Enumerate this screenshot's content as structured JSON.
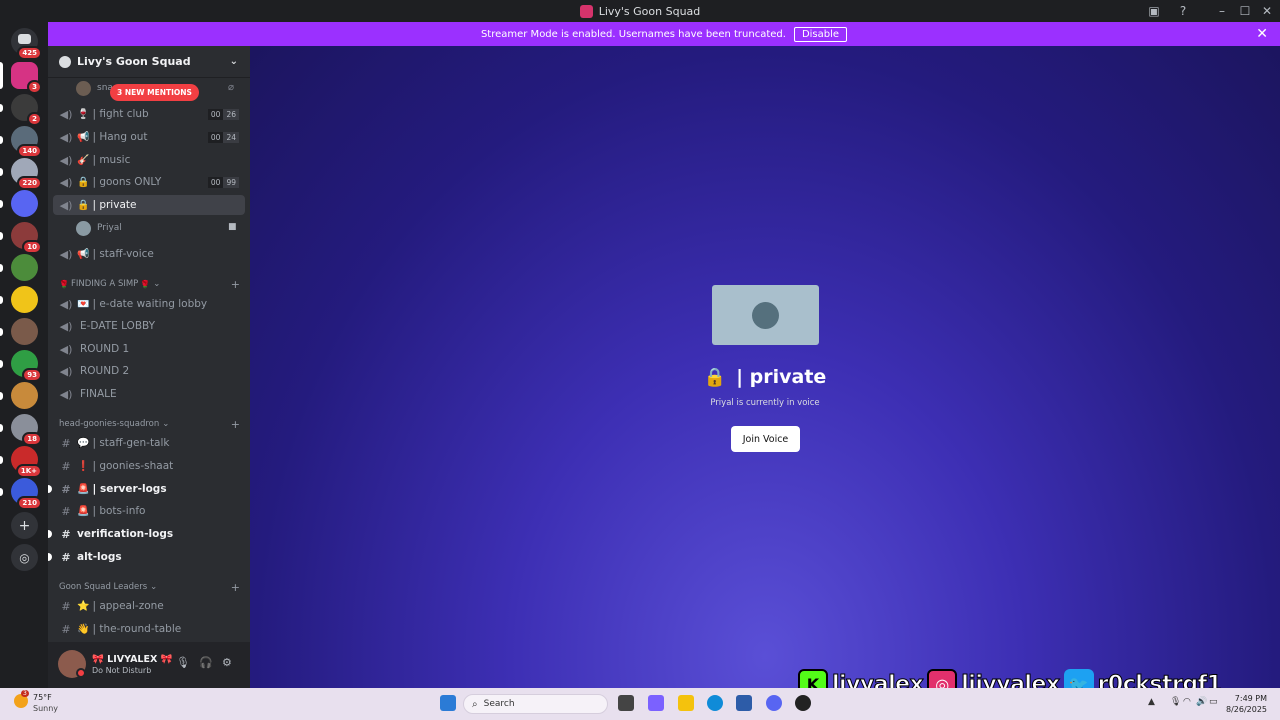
{
  "window": {
    "title": "Livy's Goon Squad"
  },
  "banner": {
    "text": "Streamer Mode is enabled. Usernames have been truncated.",
    "button": "Disable"
  },
  "rail": {
    "home_badge": "425",
    "servers": [
      {
        "badge": "3",
        "color": "#d63384"
      },
      {
        "badge": "2",
        "color": "#3b3b3b"
      },
      {
        "badge": "140",
        "color": "#5a6b7a"
      },
      {
        "badge": "220",
        "color": "#a0a8b8"
      },
      {
        "badge": "",
        "color": "#5865f2"
      },
      {
        "badge": "10",
        "color": "#8c3b3b"
      },
      {
        "badge": "",
        "color": "#4c8c3b"
      },
      {
        "badge": "",
        "color": "#f0c419"
      },
      {
        "badge": "",
        "color": "#7a5a4a"
      },
      {
        "badge": "93",
        "color": "#2f9e44"
      },
      {
        "badge": "",
        "color": "#c88a3b"
      },
      {
        "badge": "18",
        "color": "#8a8f9a"
      },
      {
        "badge": "1K+",
        "color": "#c92a2a"
      },
      {
        "badge": "210",
        "color": "#3b5bdb"
      }
    ]
  },
  "sidebar": {
    "server_name": "Livy's Goon Squad",
    "mentions_pill": "3 NEW MENTIONS",
    "top_user": "sna",
    "voice_channels": [
      {
        "name": "| fight club",
        "emoji": "🍷",
        "count": [
          "00",
          "26"
        ]
      },
      {
        "name": "| Hang out",
        "emoji": "📢",
        "count": [
          "00",
          "24"
        ]
      },
      {
        "name": "| music",
        "emoji": "🎸",
        "count": null
      },
      {
        "name": "| goons ONLY",
        "emoji": "🔒",
        "count": [
          "00",
          "99"
        ]
      },
      {
        "name": "| private",
        "emoji": "🔒",
        "count": null
      }
    ],
    "private_member": "Priyal",
    "staff_voice": {
      "name": "| staff-voice",
      "emoji": "📢"
    },
    "cat_simp": "FINDING A SIMP",
    "simp_channels": [
      {
        "name": "| e-date waiting lobby",
        "emoji": "💌"
      },
      {
        "name": "E-DATE LOBBY",
        "emoji": ""
      },
      {
        "name": "ROUND 1",
        "emoji": ""
      },
      {
        "name": "ROUND 2",
        "emoji": ""
      },
      {
        "name": "FINALE",
        "emoji": ""
      }
    ],
    "cat_head": "head-goonies-squadron",
    "head_channels": [
      {
        "name": "| staff-gen-talk",
        "emoji": "💬"
      },
      {
        "name": "| goonies-shaat",
        "emoji": "❗"
      },
      {
        "name": "| server-logs",
        "emoji": "🚨"
      },
      {
        "name": "| bots-info",
        "emoji": "🚨"
      }
    ],
    "verification": "verification-logs",
    "alt": "alt-logs",
    "cat_leaders": "Goon Squad Leaders",
    "leader_channels": [
      {
        "name": "| appeal-zone",
        "emoji": "⭐"
      },
      {
        "name": "| the-round-table",
        "emoji": "👋"
      }
    ]
  },
  "user": {
    "name": "LIVYALEX",
    "status": "Do Not Disturb"
  },
  "voice": {
    "channel_name": "| private",
    "subtitle": "Priyal is currently in voice",
    "join_label": "Join Voice"
  },
  "social": {
    "kick": "livyalex",
    "instagram": "liiyyalex",
    "twitter": "r0ckstrgf1"
  },
  "taskbar": {
    "temp": "75°F",
    "condition": "Sunny",
    "weather_badge": "3",
    "search_placeholder": "Search",
    "time": "7:49 PM",
    "date": "8/26/2025"
  }
}
